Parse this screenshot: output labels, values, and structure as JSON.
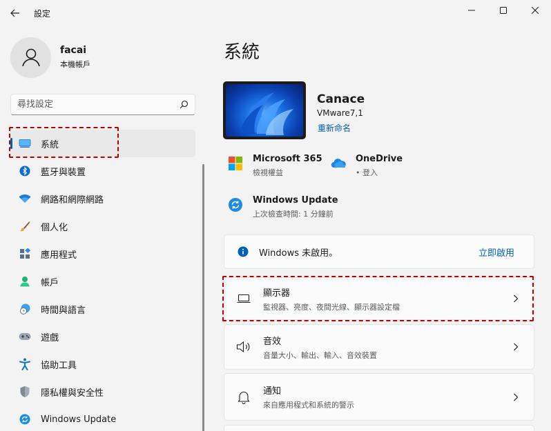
{
  "window": {
    "title": "設定"
  },
  "profile": {
    "name": "facai",
    "account_type": "本機帳戶"
  },
  "search": {
    "placeholder": "尋找設定"
  },
  "nav": {
    "items": [
      {
        "label": "系統",
        "icon": "system-icon",
        "selected": true
      },
      {
        "label": "藍牙與裝置",
        "icon": "bluetooth-icon"
      },
      {
        "label": "網路和網際網路",
        "icon": "wifi-icon"
      },
      {
        "label": "個人化",
        "icon": "brush-icon"
      },
      {
        "label": "應用程式",
        "icon": "apps-icon"
      },
      {
        "label": "帳戶",
        "icon": "account-icon"
      },
      {
        "label": "時間與語言",
        "icon": "clock-globe-icon"
      },
      {
        "label": "遊戲",
        "icon": "gamepad-icon"
      },
      {
        "label": "協助工具",
        "icon": "accessibility-icon"
      },
      {
        "label": "隱私權與安全性",
        "icon": "shield-icon"
      },
      {
        "label": "Windows Update",
        "icon": "update-icon"
      }
    ]
  },
  "main": {
    "title": "系統",
    "device": {
      "name": "Canace",
      "model": "VMware7,1",
      "rename_label": "重新命名"
    },
    "services": {
      "m365": {
        "title": "Microsoft 365",
        "subtitle": "檢視權益"
      },
      "onedrive": {
        "title": "OneDrive",
        "subtitle": "• 登入"
      },
      "update": {
        "title": "Windows Update",
        "subtitle": "上次檢查時間: 1 分鐘前"
      }
    },
    "activation": {
      "text": "Windows 未啟用。",
      "action_label": "立即啟用"
    },
    "cards": {
      "display": {
        "title": "顯示器",
        "subtitle": "監視器、亮度、夜間光線、顯示器設定檔"
      },
      "sound": {
        "title": "音效",
        "subtitle": "音量大小、輸出、輸入、音效裝置"
      },
      "notifications": {
        "title": "通知",
        "subtitle": "來自應用程式和系統的警示"
      }
    }
  },
  "colors": {
    "accent": "#005fb8",
    "highlight_box": "#c00000",
    "background": "#f3f3f3",
    "card": "#fbfbfb"
  }
}
